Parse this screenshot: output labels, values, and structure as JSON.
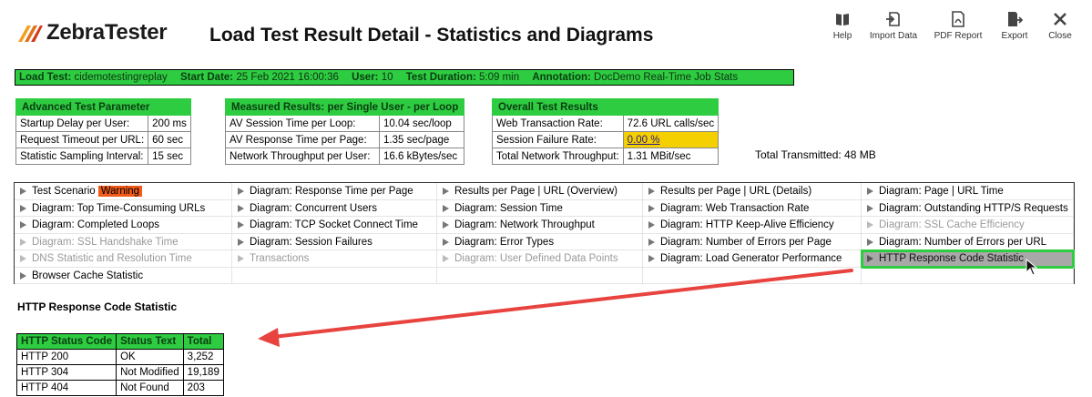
{
  "app": {
    "logo_text": "ZebraTester",
    "title": "Load Test Result Detail - Statistics and Diagrams"
  },
  "toolbar": [
    {
      "label": "Help",
      "icon": "book-icon"
    },
    {
      "label": "Import Data",
      "icon": "import-icon"
    },
    {
      "label": "PDF Report",
      "icon": "pdf-icon"
    },
    {
      "label": "Export",
      "icon": "export-icon"
    },
    {
      "label": "Close",
      "icon": "close-icon"
    }
  ],
  "info": {
    "load_test_label": "Load Test:",
    "load_test": "cidemotestingreplay",
    "start_date_label": "Start Date:",
    "start_date": "25 Feb 2021 16:00:36",
    "user_label": "User:",
    "user": "10",
    "duration_label": "Test Duration:",
    "duration": "5:09 min",
    "annotation_label": "Annotation:",
    "annotation": "DocDemo Real-Time Job Stats"
  },
  "advanced": {
    "header": "Advanced Test Parameter",
    "rows": [
      {
        "label": "Startup Delay per User:",
        "value": "200 ms"
      },
      {
        "label": "Request Timeout per URL:",
        "value": "60 sec"
      },
      {
        "label": "Statistic Sampling Interval:",
        "value": "15 sec"
      }
    ]
  },
  "measured": {
    "header": "Measured Results: per Single User - per Loop",
    "rows": [
      {
        "label": "AV Session Time per Loop:",
        "value": "10.04 sec/loop"
      },
      {
        "label": "AV Response Time per Page:",
        "value": "1.35 sec/page"
      },
      {
        "label": "Network Throughput per User:",
        "value": "16.6 kBytes/sec"
      }
    ]
  },
  "overall": {
    "header": "Overall Test Results",
    "rows": [
      {
        "label": "Web Transaction Rate:",
        "value": "72.6 URL calls/sec"
      },
      {
        "label": "Session Failure Rate:",
        "value": "0.00 %"
      },
      {
        "label": "Total Network Throughput:",
        "value": "1.31 MBit/sec"
      }
    ],
    "total_transmitted": "Total Transmitted: 48 MB"
  },
  "nav": {
    "warning_badge": "Warning",
    "rows": [
      [
        "Test Scenario",
        "Diagram: Response Time per Page",
        "Results per Page | URL (Overview)",
        "Results per Page | URL (Details)",
        "Diagram: Page | URL Time"
      ],
      [
        "Diagram: Top Time-Consuming URLs",
        "Diagram: Concurrent Users",
        "Diagram: Session Time",
        "Diagram: Web Transaction Rate",
        "Diagram: Outstanding HTTP/S Requests"
      ],
      [
        "Diagram: Completed Loops",
        "Diagram: TCP Socket Connect Time",
        "Diagram: Network Throughput",
        "Diagram: HTTP Keep-Alive Efficiency",
        "Diagram: SSL Cache Efficiency"
      ],
      [
        "Diagram: SSL Handshake Time",
        "Diagram: Session Failures",
        "Diagram: Error Types",
        "Diagram: Number of Errors per Page",
        "Diagram: Number of Errors per URL"
      ],
      [
        "DNS Statistic and Resolution Time",
        "Transactions",
        "Diagram: User Defined Data Points",
        "Diagram: Load Generator Performance",
        "HTTP Response Code Statistic"
      ],
      [
        "Browser Cache Statistic",
        "",
        "",
        "",
        ""
      ]
    ],
    "dimmed": [
      "Diagram: SSL Cache Efficiency",
      "Diagram: SSL Handshake Time",
      "DNS Statistic and Resolution Time",
      "Transactions",
      "Diagram: User Defined Data Points"
    ],
    "selected": "HTTP Response Code Statistic"
  },
  "section": {
    "title": "HTTP Response Code Statistic",
    "columns": [
      "HTTP Status Code",
      "Status Text",
      "Total"
    ],
    "rows": [
      [
        "HTTP 200",
        "OK",
        "3,252"
      ],
      [
        "HTTP 304",
        "Not Modified",
        "19,189"
      ],
      [
        "HTTP 404",
        "Not Found",
        "203"
      ]
    ]
  },
  "colors": {
    "accent_green": "#2ecc40",
    "warning_orange": "#f05a1a",
    "highlight_yellow": "#f5d000",
    "arrow_red": "#e8433f"
  }
}
